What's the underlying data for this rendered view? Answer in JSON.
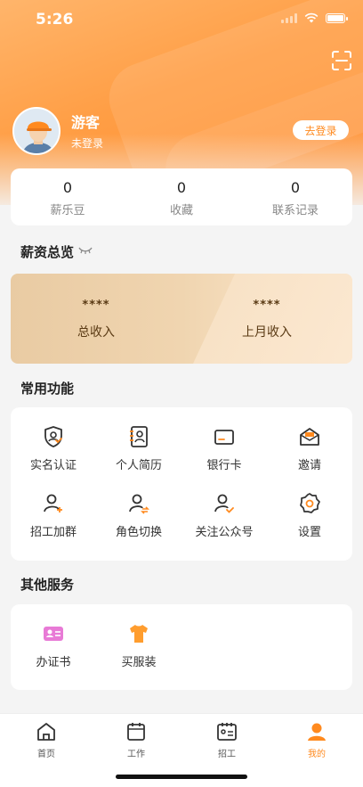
{
  "status_bar": {
    "time": "5:26"
  },
  "profile": {
    "name": "游客",
    "status": "未登录",
    "login_button": "去登录"
  },
  "stats": [
    {
      "value": "0",
      "label": "薪乐豆"
    },
    {
      "value": "0",
      "label": "收藏"
    },
    {
      "value": "0",
      "label": "联系记录"
    }
  ],
  "salary": {
    "title": "薪资总览",
    "total_value": "****",
    "total_label": "总收入",
    "last_month_value": "****",
    "last_month_label": "上月收入"
  },
  "common": {
    "title": "常用功能",
    "items": [
      {
        "label": "实名认证",
        "icon": "id-verify-icon"
      },
      {
        "label": "个人简历",
        "icon": "resume-icon"
      },
      {
        "label": "银行卡",
        "icon": "bank-card-icon"
      },
      {
        "label": "邀请",
        "icon": "invite-icon"
      },
      {
        "label": "招工加群",
        "icon": "recruit-group-icon"
      },
      {
        "label": "角色切换",
        "icon": "role-switch-icon"
      },
      {
        "label": "关注公众号",
        "icon": "follow-account-icon"
      },
      {
        "label": "设置",
        "icon": "settings-icon"
      }
    ]
  },
  "other": {
    "title": "其他服务",
    "items": [
      {
        "label": "办证书",
        "icon": "certificate-icon"
      },
      {
        "label": "买服装",
        "icon": "clothing-icon"
      }
    ]
  },
  "tabbar": [
    {
      "label": "首页",
      "icon": "home-icon"
    },
    {
      "label": "工作",
      "icon": "work-icon"
    },
    {
      "label": "招工",
      "icon": "recruit-icon"
    },
    {
      "label": "我的",
      "icon": "me-icon",
      "active": true
    }
  ],
  "colors": {
    "accent": "#ff8a1f",
    "hero": "#ff9e45"
  }
}
